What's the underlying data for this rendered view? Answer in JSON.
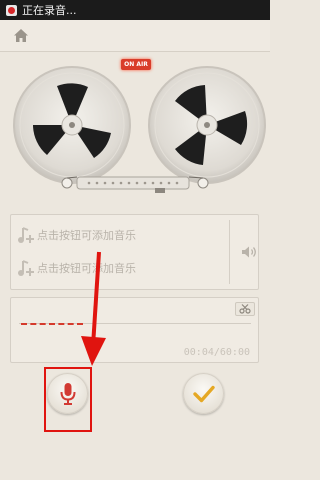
{
  "status_bar": {
    "text": "正在录音..."
  },
  "header": {
    "home_icon": "home-icon"
  },
  "recorder": {
    "on_air_label": "ON AIR",
    "on_air_color": "#d93d2b"
  },
  "playlist": {
    "items": [
      {
        "label": "点击按钮可添加音乐",
        "icon": "music-note-add-icon"
      },
      {
        "label": "点击按钮可添加音乐",
        "icon": "music-note-add-icon"
      }
    ],
    "volume_icon": "speaker-icon"
  },
  "recording": {
    "elapsed": "00:04/60:00",
    "progress_fraction": 0.0011,
    "trim_icon": "scissors-icon",
    "wave_color": "#d53a2c"
  },
  "controls": {
    "mic_icon": "microphone-icon",
    "confirm_icon": "checkmark-icon",
    "mic_color": "#d23a33",
    "check_color": "#e5a824"
  },
  "annotation": {
    "box_color": "#e0140f",
    "arrow_color": "#e0140f"
  }
}
